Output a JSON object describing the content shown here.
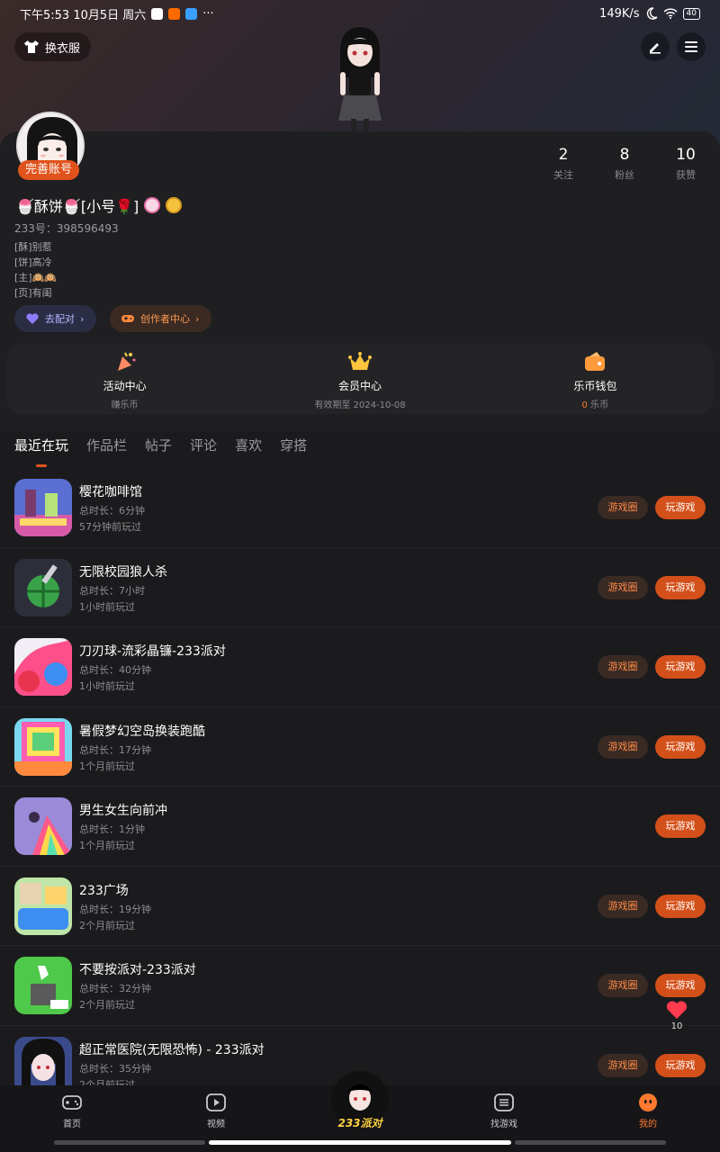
{
  "status": {
    "time_date": "下午5:53 10月5日 周六",
    "more": "···",
    "network_speed": "149K/s",
    "battery": "40"
  },
  "header": {
    "outfit_label": "换衣服",
    "edit_icon": "pencil-icon",
    "menu_icon": "hamburger-menu-icon"
  },
  "profile": {
    "complete_badge": "完善账号",
    "nickname": "🍧酥饼🍧[小号🌹]",
    "uid": "233号：398596493",
    "bio": [
      "[酥]别惹",
      "[饼]高冷",
      "[主]🙉🙉",
      "[页]有闺"
    ],
    "stats": [
      {
        "num": "2",
        "label": "关注"
      },
      {
        "num": "8",
        "label": "粉丝"
      },
      {
        "num": "10",
        "label": "获赞"
      }
    ],
    "chips": {
      "pair": "去配对",
      "creator": "创作者中心"
    }
  },
  "services": [
    {
      "title": "活动中心",
      "sub": "赚乐币"
    },
    {
      "title": "会员中心",
      "sub": "有效期至 2024-10-08"
    },
    {
      "title": "乐币钱包",
      "sub_value": "0",
      "sub_unit": " 乐币"
    }
  ],
  "tabs": [
    "最近在玩",
    "作品栏",
    "帖子",
    "评论",
    "喜欢",
    "穿搭"
  ],
  "games": [
    {
      "name": "樱花咖啡馆",
      "duration": "总时长：6分钟",
      "last_played": "57分钟前玩过",
      "circle": "游戏圈",
      "play": "玩游戏"
    },
    {
      "name": "无限校园狼人杀",
      "duration": "总时长：7小时",
      "last_played": "1小时前玩过",
      "circle": "游戏圈",
      "play": "玩游戏"
    },
    {
      "name": "刀刃球-流彩晶镰-233派对",
      "duration": "总时长：40分钟",
      "last_played": "1小时前玩过",
      "circle": "游戏圈",
      "play": "玩游戏"
    },
    {
      "name": "暑假梦幻空岛换装跑酷",
      "duration": "总时长：17分钟",
      "last_played": "1个月前玩过",
      "circle": "游戏圈",
      "play": "玩游戏"
    },
    {
      "name": "男生女生向前冲",
      "duration": "总时长：1分钟",
      "last_played": "1个月前玩过",
      "circle": "",
      "play": "玩游戏"
    },
    {
      "name": "233广场",
      "duration": "总时长：19分钟",
      "last_played": "2个月前玩过",
      "circle": "游戏圈",
      "play": "玩游戏"
    },
    {
      "name": "不要按派对-233派对",
      "duration": "总时长：32分钟",
      "last_played": "2个月前玩过",
      "circle": "游戏圈",
      "play": "玩游戏"
    },
    {
      "name": "超正常医院(无限恐怖) - 233派对",
      "duration": "总时长：35分钟",
      "last_played": "2个月前玩过",
      "circle": "游戏圈",
      "play": "玩游戏"
    }
  ],
  "float_like": {
    "count": "10"
  },
  "nav": {
    "home": "首页",
    "video": "视频",
    "brand": "233派对",
    "find": "找游戏",
    "me": "我的"
  },
  "colors": {
    "accent": "#e0531c",
    "accent_text": "#ff7a2f",
    "background": "#1b1b1d"
  }
}
